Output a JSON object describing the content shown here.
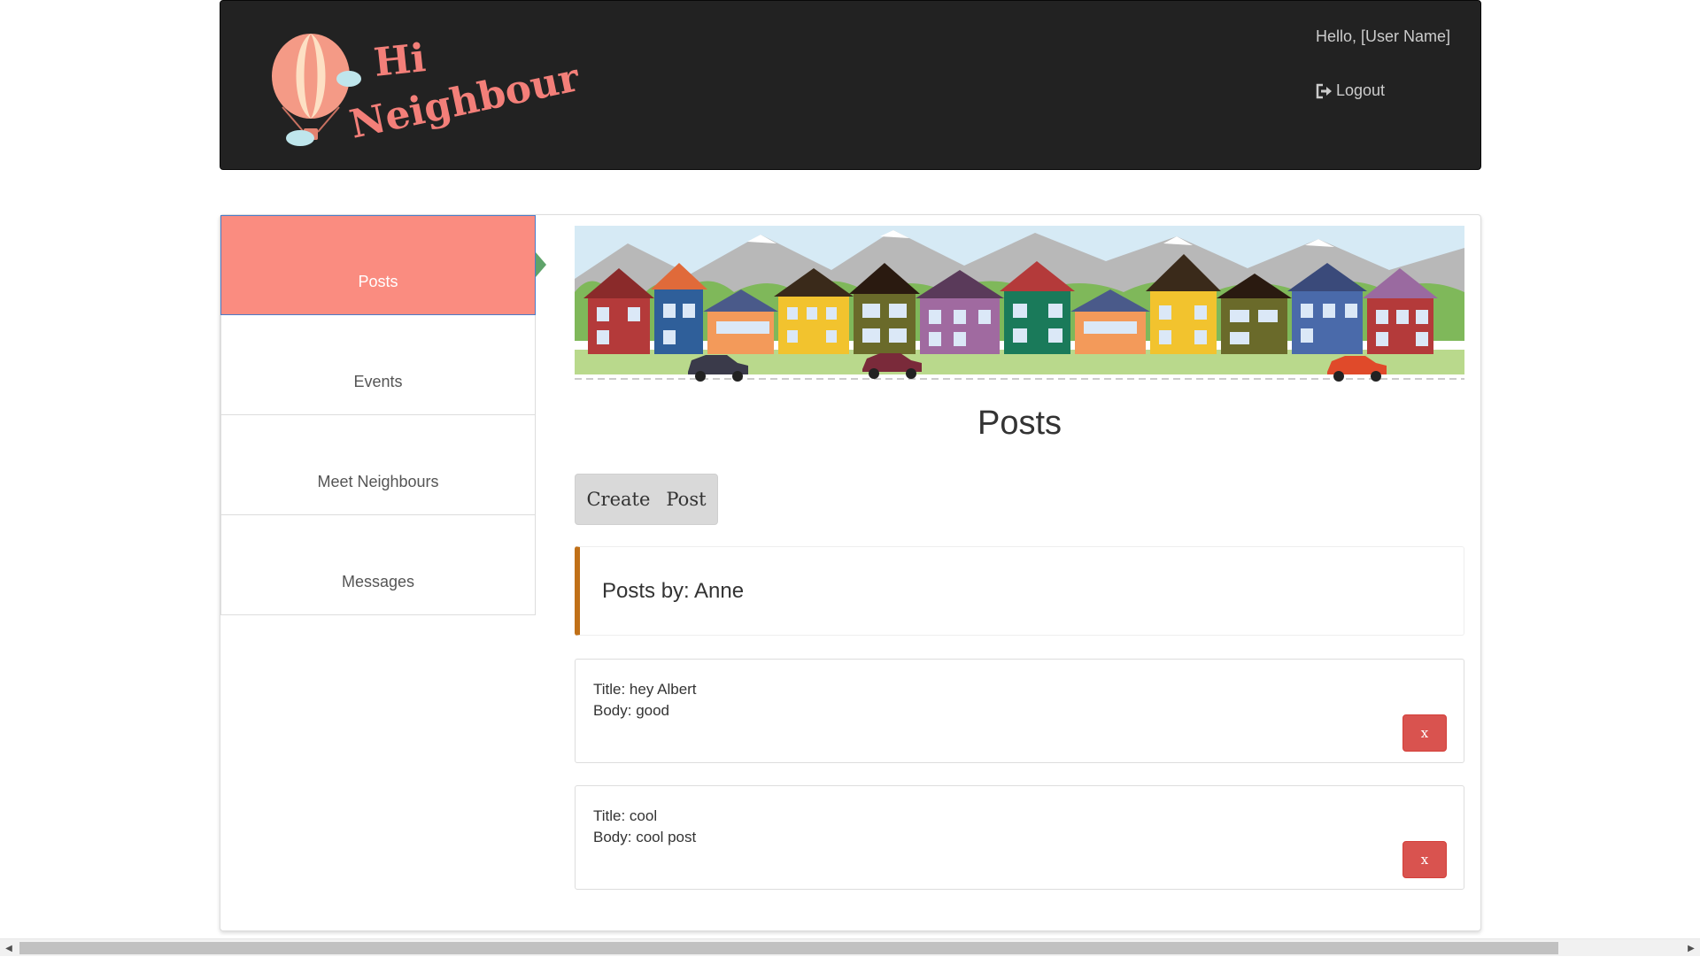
{
  "header": {
    "logo_text": "Hi Neighbour",
    "greeting": "Hello, [User Name]",
    "logout_label": "Logout"
  },
  "sidebar": {
    "items": [
      {
        "label": "Posts",
        "active": true
      },
      {
        "label": "Events",
        "active": false
      },
      {
        "label": "Meet Neighbours",
        "active": false
      },
      {
        "label": "Messages",
        "active": false
      }
    ]
  },
  "main": {
    "title": "Posts",
    "create_button": {
      "word1": "Create",
      "word2": "Post"
    },
    "posts_by": "Posts by: Anne",
    "posts": [
      {
        "title": "Title: hey Albert",
        "body": "Body: good",
        "delete_label": "x"
      },
      {
        "title": "Title: cool",
        "body": "Body: cool post",
        "delete_label": "x"
      }
    ]
  },
  "colors": {
    "header_bg": "#222222",
    "active_nav": "#fa8c80",
    "delete_button": "#d9534f",
    "posts_by_accent": "#c07018"
  }
}
